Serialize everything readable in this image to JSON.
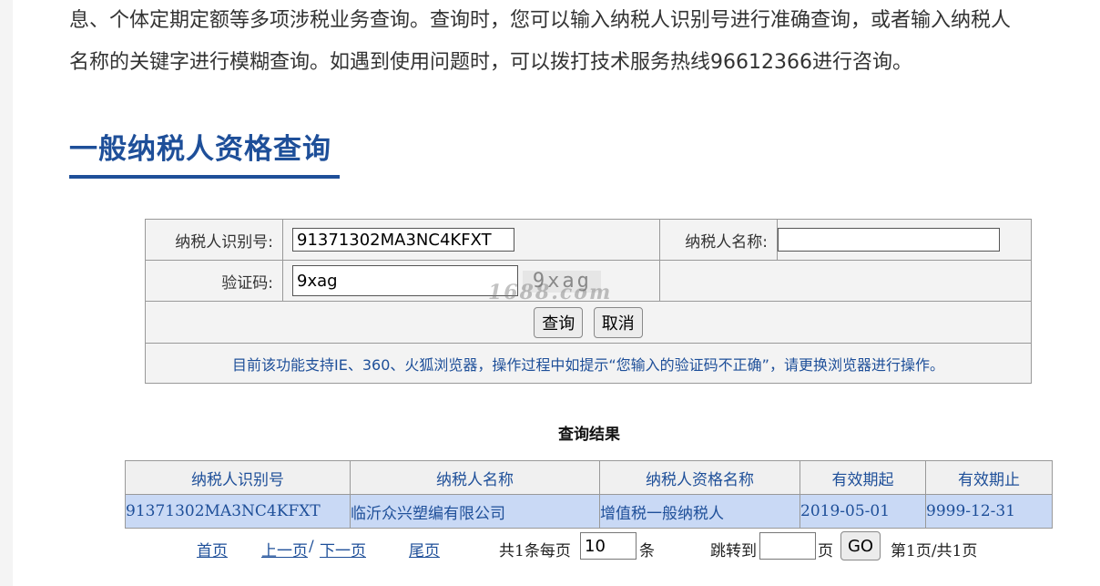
{
  "intro": {
    "line1": "息、个体定期定额等多项涉税业务查询。查询时，您可以输入纳税人识别号进行准确查询，或者输入纳税人",
    "line2": "名称的关键字进行模糊查询。如遇到使用问题时，可以拨打技术服务热线96612366进行咨询。"
  },
  "heading": "一般纳税人资格查询",
  "form": {
    "taxpayer_id_label": "纳税人识别号:",
    "taxpayer_id_value": "91371302MA3NC4KFXT",
    "taxpayer_name_label": "纳税人名称:",
    "taxpayer_name_value": "",
    "captcha_label": "验证码:",
    "captcha_value": "9xag",
    "captcha_image_text": "9xag",
    "query_button": "查询",
    "cancel_button": "取消",
    "note": "目前该功能支持IE、360、火狐浏览器，操作过程中如提示“您输入的验证码不正确”，请更换浏览器进行操作。"
  },
  "watermark": "1688.com",
  "results": {
    "title": "查询结果",
    "columns": [
      "纳税人识别号",
      "纳税人名称",
      "纳税人资格名称",
      "有效期起",
      "有效期止"
    ],
    "rows": [
      [
        "91371302MA3NC4KFXT",
        "临沂众兴塑编有限公司",
        "增值税一般纳税人",
        "2019-05-01",
        "9999-12-31"
      ]
    ]
  },
  "pager": {
    "first": "首页",
    "prev": "上一页",
    "sep": "/",
    "next": "下一页",
    "last": "尾页",
    "total_prefix": "共1条每页",
    "per_page": "10",
    "per_page_suffix": "条",
    "jump_label": "跳转到",
    "jump_value": "",
    "page_suffix": "页",
    "go_button": "GO",
    "page_info": "第1页/共1页"
  },
  "colors": {
    "accent": "#1e4f99",
    "row_highlight": "#c9d9f5"
  }
}
